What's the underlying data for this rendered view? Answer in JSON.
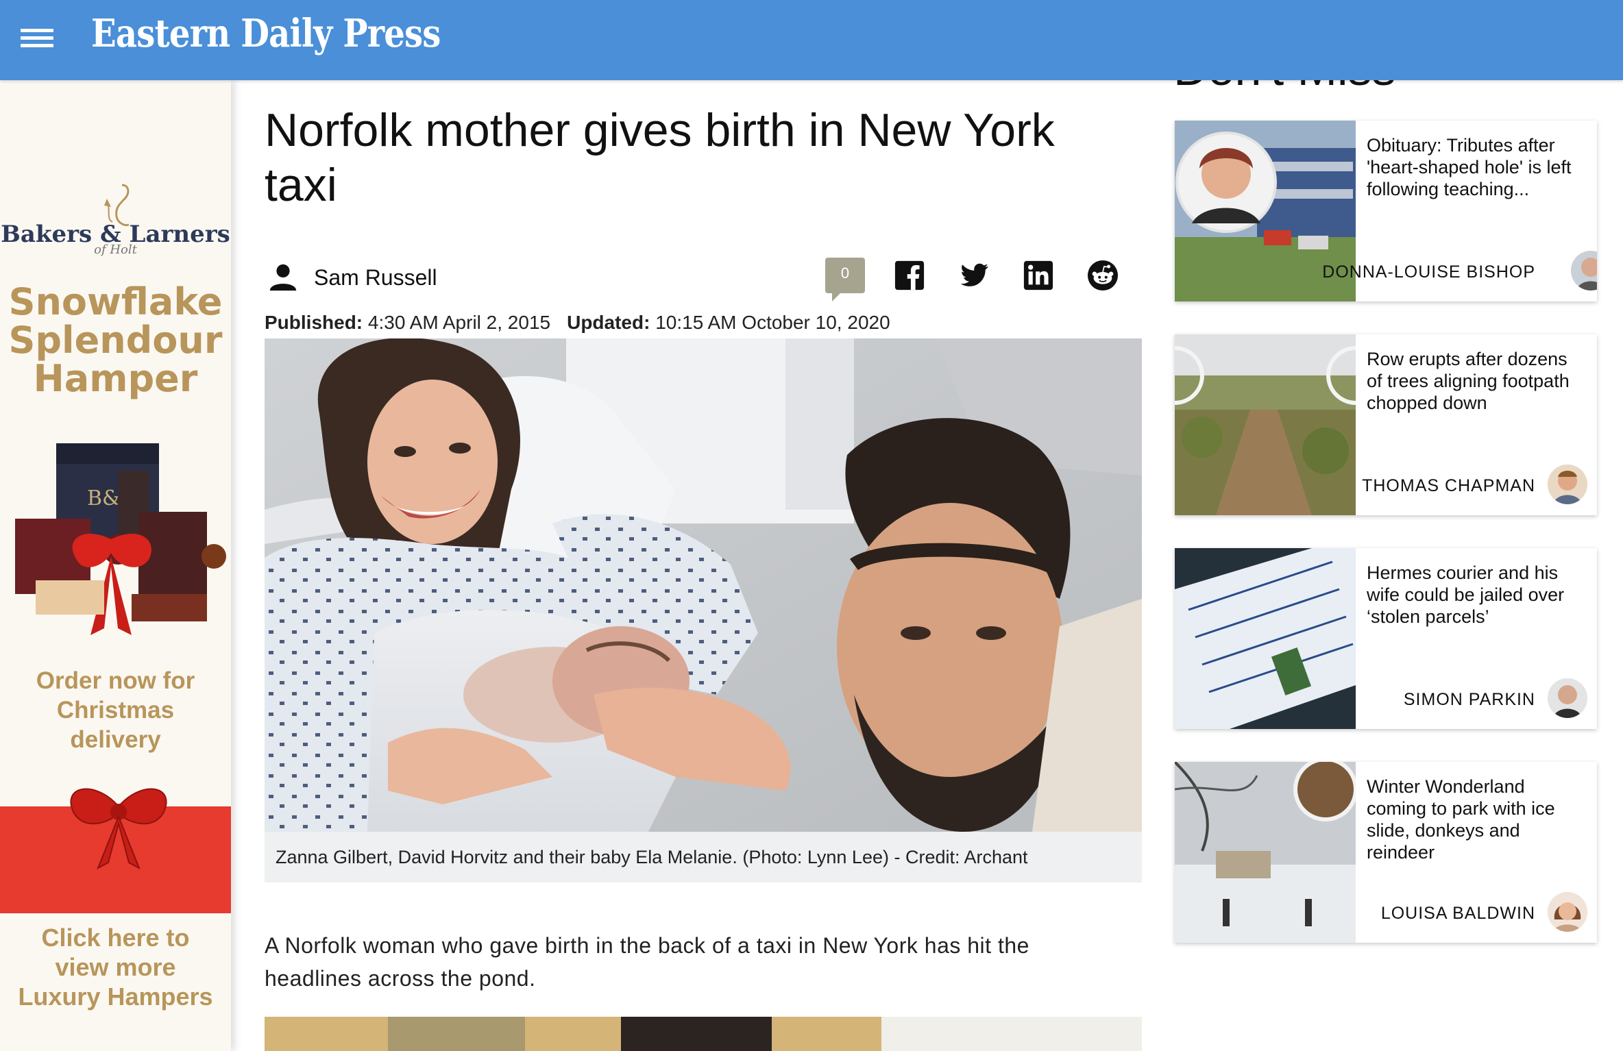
{
  "header": {
    "brand": "Eastern Daily Press",
    "menu_icon": "hamburger-menu-icon"
  },
  "ad": {
    "logo": "Bakers & Larners",
    "logo_sub": "of Holt",
    "title_lines": [
      "Snowflake",
      "Splendour",
      "Hamper"
    ],
    "hamper_label": "B&L",
    "order_lines": [
      "Order now for",
      "Christmas",
      "delivery"
    ],
    "click_lines": [
      "Click here to",
      "view more",
      "Luxury Hampers"
    ],
    "colors": {
      "gold": "#b8955a",
      "red": "#e63b2e",
      "navy": "#2d3a5a"
    }
  },
  "article": {
    "headline": "Norfolk mother gives birth in New York taxi",
    "author": "Sam Russell",
    "comment_count": "0",
    "share_icons": [
      "facebook-icon",
      "twitter-icon",
      "linkedin-icon",
      "reddit-icon"
    ],
    "published_label": "Published:",
    "published_value": "4:30 AM April 2, 2015",
    "updated_label": "Updated:",
    "updated_value": "10:15 AM October 10, 2020",
    "caption": "Zanna Gilbert, David Horvitz and their baby Ela Melanie. (Photo: Lynn Lee) - Credit: Archant",
    "intro": "A Norfolk woman who gave birth in the back of a taxi in New York has hit the headlines across the pond."
  },
  "sidebar": {
    "title": "Don't Miss",
    "cards": [
      {
        "title": "Obituary: Tributes after 'heart-shaped hole' is left following teaching...",
        "author": "Donna-Louise Bishop"
      },
      {
        "title": "Row erupts after dozens of trees aligning footpath chopped down",
        "author": "Thomas Chapman"
      },
      {
        "title": "Hermes courier and his wife could be jailed over ‘stolen parcels’",
        "author": "Simon Parkin"
      },
      {
        "title": "Winter Wonderland coming to park with ice slide, donkeys and reindeer",
        "author": "Louisa Baldwin"
      }
    ]
  },
  "colors": {
    "header_bg": "#4a8fd8",
    "caption_bg": "#eef0f2",
    "comment_badge": "#a6a38f"
  }
}
